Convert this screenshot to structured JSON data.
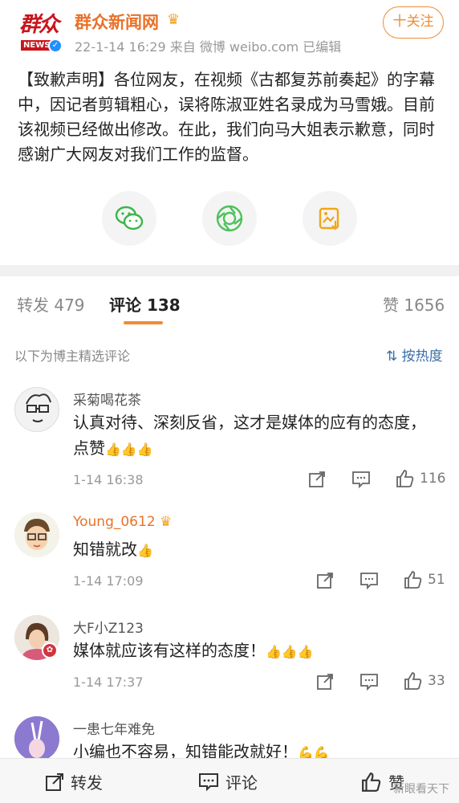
{
  "post": {
    "account_name": "群众新闻网",
    "logo_text": "群众",
    "logo_news": "NEWS",
    "meta": "22-1-14 16:29  来自 微博 weibo.com  已编辑",
    "follow_label": "十关注",
    "text": "【致歉声明】各位网友，在视频《古都复苏前奏起》的字幕中，因记者剪辑粗心，误将陈淑亚姓名录成为马雪娥。目前该视频已经做出修改。在此，我们向马大姐表示歉意，同时感谢广大网友对我们工作的监督。",
    "share_icons": [
      "wechat-icon",
      "moments-icon",
      "save-image-icon"
    ],
    "colors": {
      "accent": "#f08b34",
      "brand_red": "#c9141c",
      "wechat_green": "#3ab649",
      "moments_green": "#4cc25a",
      "save_orange": "#f2a516"
    }
  },
  "tabs": [
    {
      "label": "转发 479"
    },
    {
      "label": "评论 138"
    },
    {
      "label": "赞 1656"
    }
  ],
  "filter": {
    "label": "以下为博主精选评论",
    "sort": "按热度"
  },
  "comments": [
    {
      "user": "采菊喝花茶",
      "text": "认真对待、深刻反省，这才是媒体的应有的态度，点赞",
      "emoji": "👍👍👍",
      "time": "1-14 16:38",
      "likes": "116"
    },
    {
      "user": "Young_0612",
      "text": "知错就改",
      "emoji": "👍",
      "time": "1-14 17:09",
      "likes": "51"
    },
    {
      "user": "大F小Z123",
      "text": "媒体就应该有这样的态度！",
      "emoji": "👍👍👍",
      "time": "1-14 17:37",
      "likes": "33"
    },
    {
      "user": "一患七年难免",
      "text": "小编也不容易，知错能改就好！",
      "emoji": "💪💪",
      "time": "",
      "likes": ""
    }
  ],
  "bottom_bar": {
    "repost": "转发",
    "comment": "评论",
    "like": "赞"
  },
  "watermark": "新眼看天下"
}
